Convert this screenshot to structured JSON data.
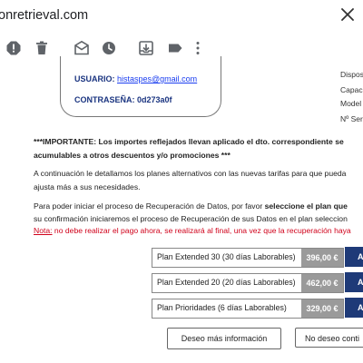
{
  "window": {
    "title": "onretrieval.com"
  },
  "icons": [
    "close-icon",
    "report-spam-icon",
    "delete-icon",
    "mark-unread-icon",
    "snooze-icon",
    "move-to-icon",
    "label-icon",
    "more-vert-icon"
  ],
  "credentials": {
    "user_label": "USUARIO:",
    "user_value": "histaspes@gmail.com",
    "pass_label": "CONTRASEÑA:",
    "pass_value": "0d273a0f"
  },
  "side_labels": [
    "Dispos",
    "Capac",
    "Model",
    "Nº Ser"
  ],
  "body": {
    "important_1": "***IMPORTANTE: Los importes reflejados llevan aplicado el dto. correspondiente se",
    "important_2": "acumulables a otros descuentos y/o promociones ***",
    "para1_line1": "A continuación le detallamos los planes alternativos con las nuevas tarifas para que pueda",
    "para1_line2": "ajusta más a sus necesidades.",
    "para2_line1_a": "Para poder iniciar el proceso de Recuperación de Datos, por favor ",
    "para2_line1_b": "seleccione el plan que",
    "para2_line2": "su confirmación iniciaremos el proceso de Recuperación de sus Datos en el plan seleccion",
    "note_label": "Nota:",
    "note_text": " no debe realizar el pago ahora, se realizará al final, una vez que la recuperación haya"
  },
  "plans": [
    {
      "name": "Plan Extended 30 (30 días Laborables)",
      "price": "396,00 €",
      "action": "A"
    },
    {
      "name": "Plan Extended 20 (20 días Laborables)",
      "price": "462,00 €",
      "action": "A"
    },
    {
      "name": "Plan Prioridades (6 días Laborables)",
      "price": "329,00 €",
      "action": "A"
    }
  ],
  "footer_buttons": {
    "more_info": "Deseo más información",
    "no_continue": "No deseo conti"
  },
  "colors": {
    "navy": "#1e3a78",
    "price_gray": "#9a9a9a",
    "link_blue": "#1a3df0",
    "note_red": "#d0021b"
  }
}
